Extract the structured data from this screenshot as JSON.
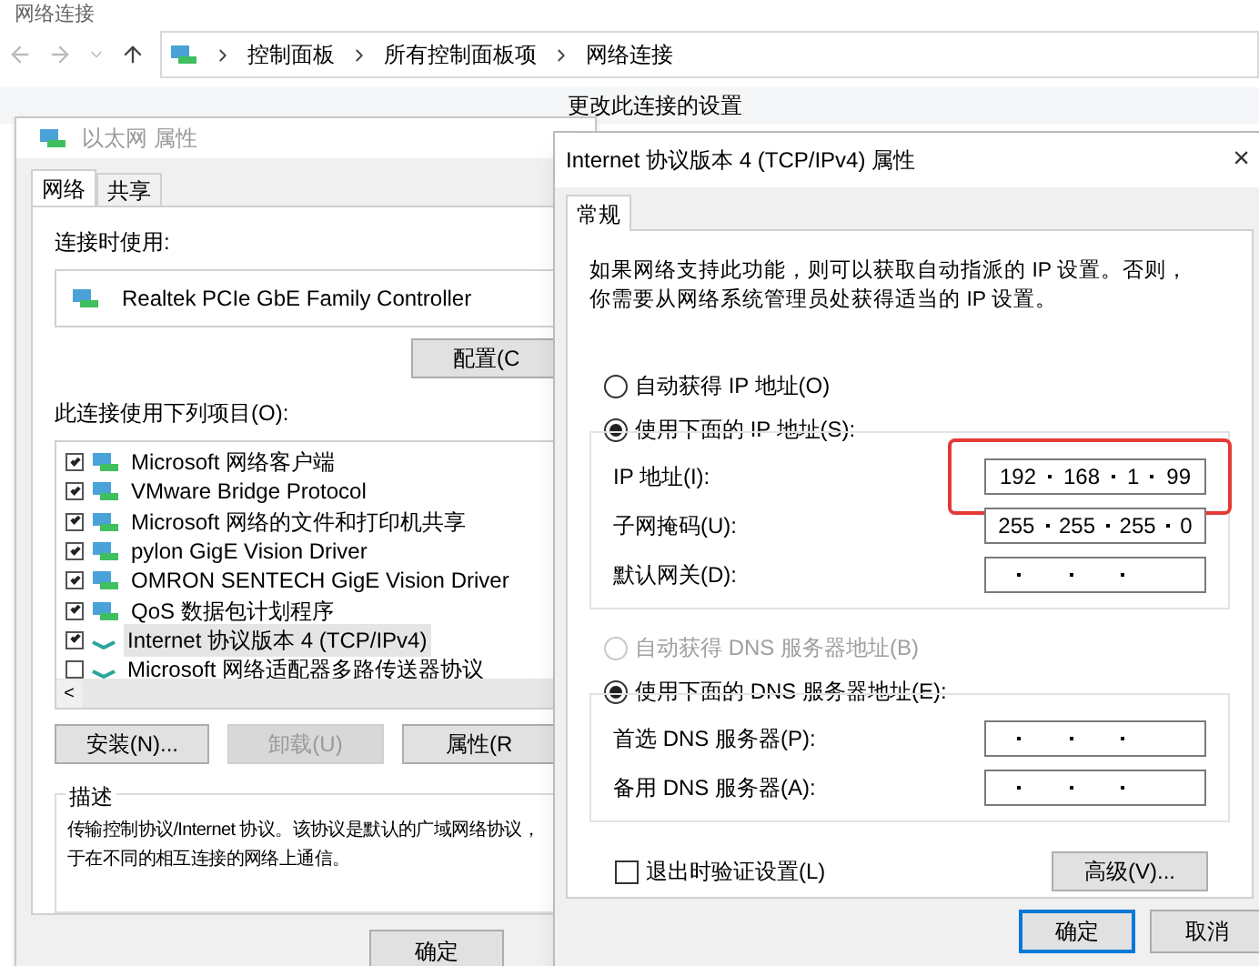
{
  "explorer": {
    "title": "网络连接",
    "breadcrumb": [
      "控制面板",
      "所有控制面板项",
      "网络连接"
    ],
    "toolbar": [
      "更改此连接的设置"
    ]
  },
  "ethernet_dialog": {
    "title": "以太网 属性",
    "tabs": [
      {
        "label": "网络",
        "selected": true
      },
      {
        "label": "共享",
        "selected": false
      }
    ],
    "connect_using_label": "连接时使用:",
    "adapter": "Realtek PCIe GbE Family Controller",
    "configure_button": "配置(C",
    "items_label": "此连接使用下列项目(O):",
    "items": [
      {
        "label": "Microsoft 网络客户端",
        "checked": true,
        "selected": false,
        "kind": "client"
      },
      {
        "label": "VMware Bridge Protocol",
        "checked": true,
        "selected": false,
        "kind": "client"
      },
      {
        "label": "Microsoft 网络的文件和打印机共享",
        "checked": true,
        "selected": false,
        "kind": "client"
      },
      {
        "label": "pylon GigE Vision Driver",
        "checked": true,
        "selected": false,
        "kind": "client"
      },
      {
        "label": "OMRON SENTECH GigE Vision Driver",
        "checked": true,
        "selected": false,
        "kind": "client"
      },
      {
        "label": "QoS 数据包计划程序",
        "checked": true,
        "selected": false,
        "kind": "client"
      },
      {
        "label": "Internet 协议版本 4 (TCP/IPv4)",
        "checked": true,
        "selected": true,
        "kind": "protocol"
      },
      {
        "label": "Microsoft 网络适配器多路传送器协议",
        "checked": false,
        "selected": false,
        "kind": "protocol"
      }
    ],
    "scroll_left": "<",
    "buttons": [
      {
        "label": "安装(N)...",
        "disabled": false
      },
      {
        "label": "卸载(U)",
        "disabled": true
      },
      {
        "label": "属性(R",
        "disabled": false
      }
    ],
    "description_title": "描述",
    "description": [
      "传输控制协议/Internet 协议。该协议是默认的广域网络协议，",
      "于在不同的相互连接的网络上通信。"
    ],
    "footer_buttons": [
      "确定"
    ]
  },
  "ipv4_dialog": {
    "title": "Internet 协议版本 4 (TCP/IPv4) 属性",
    "close": "×",
    "tabs": [
      {
        "label": "常规",
        "selected": true
      }
    ],
    "intro": "如果网络支持此功能，则可以获取自动指派的 IP 设置。否则，你需要从网络系统管理员处获得适当的 IP 设置。",
    "ip_radios": [
      {
        "label": "自动获得 IP 地址(O)",
        "selected": false,
        "disabled": false
      },
      {
        "label": "使用下面的 IP 地址(S):",
        "selected": true,
        "disabled": false
      }
    ],
    "ip_fields": [
      {
        "label": "IP 地址(I):",
        "octets": [
          "192",
          "168",
          "1",
          "99"
        ],
        "highlighted": true
      },
      {
        "label": "子网掩码(U):",
        "octets": [
          "255",
          "255",
          "255",
          "0"
        ],
        "highlighted": false
      },
      {
        "label": "默认网关(D):",
        "highlighted": false
      }
    ],
    "dns_radios": [
      {
        "label": "自动获得 DNS 服务器地址(B)",
        "selected": false,
        "disabled": true
      },
      {
        "label": "使用下面的 DNS 服务器地址(E):",
        "selected": true,
        "disabled": false
      }
    ],
    "dns_fields": [
      {
        "label": "首选 DNS 服务器(P):",
        "highlighted": false
      },
      {
        "label": "备用 DNS 服务器(A):",
        "highlighted": false
      }
    ],
    "validate_checkbox": {
      "label": "退出时验证设置(L)",
      "checked": false
    },
    "advanced_button": "高级(V)...",
    "footer_buttons": [
      {
        "label": "确定",
        "default": true
      },
      {
        "label": "取消",
        "default": false
      }
    ]
  }
}
